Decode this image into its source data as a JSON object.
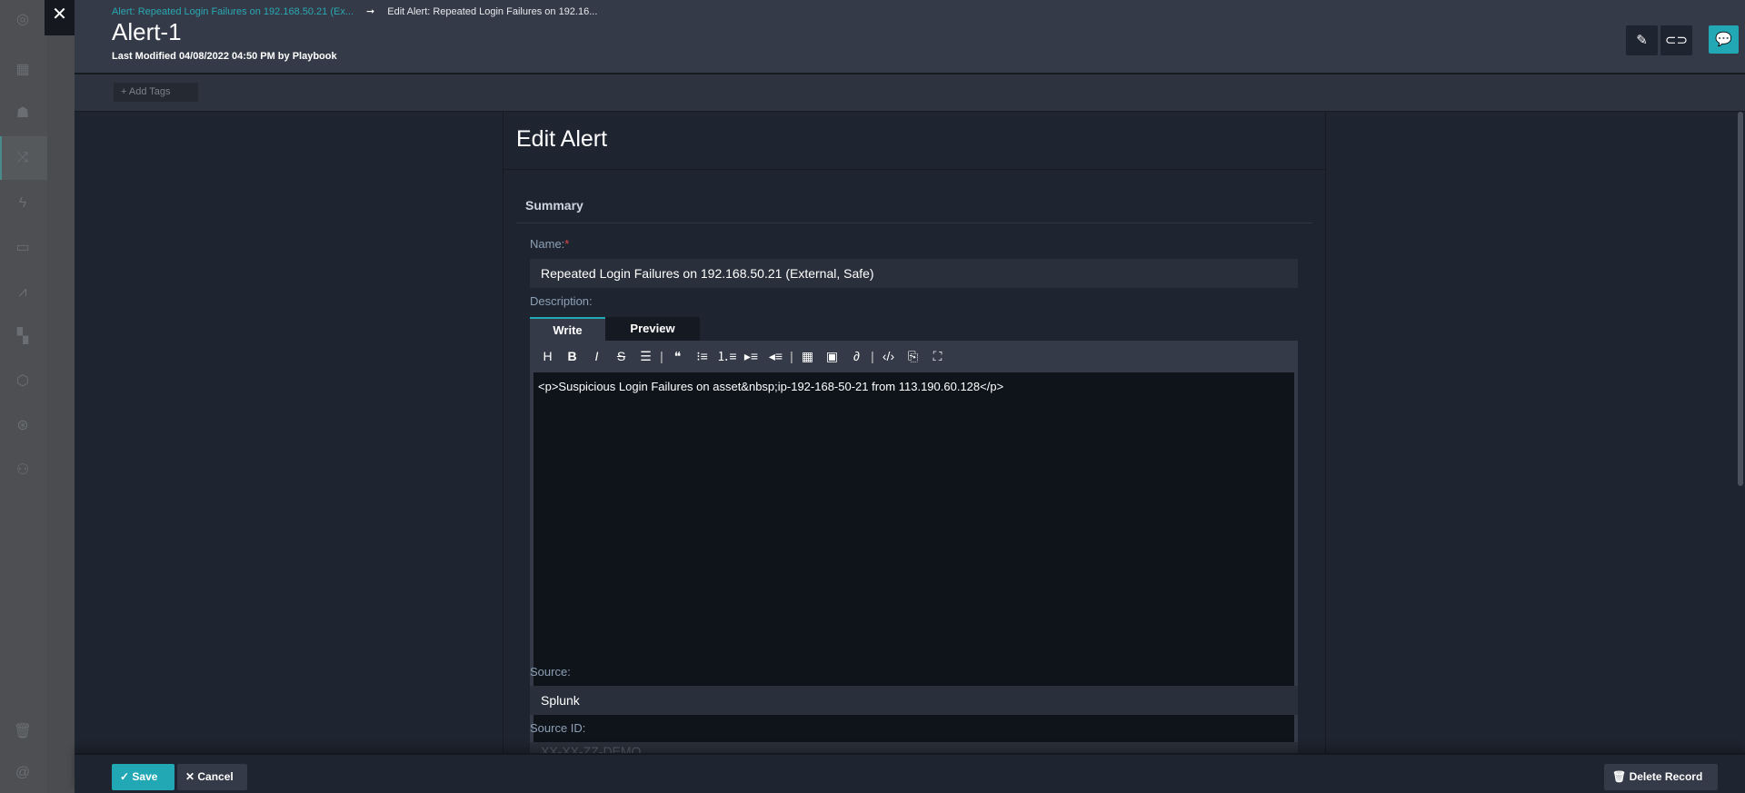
{
  "header": {
    "breadcrumb_parent": "Alert: Repeated Login Failures on 192.168.50.21 (Ex...",
    "breadcrumb_current": "Edit Alert: Repeated Login Failures on 192.16...",
    "title": "Alert-1",
    "last_modified": "Last Modified 04/08/2022 04:50 PM by Playbook",
    "status_color": "#4caf1f"
  },
  "tags": {
    "add_label": "+ Add Tags"
  },
  "panel": {
    "title": "Edit Alert",
    "section": "Summary",
    "name_label": "Name:",
    "required_mark": "*",
    "name_value": "Repeated Login Failures on 192.168.50.21 (External, Safe)",
    "description_label": "Description:",
    "tabs": [
      "Write",
      "Preview"
    ],
    "active_tab": "Write",
    "description_value": "<p>Suspicious Login Failures on asset&nbsp;ip-192-168-50-21 from 113.190.60.128</p>",
    "source_label": "Source:",
    "source_value": "Splunk",
    "source_id_label": "Source ID:",
    "source_id_value": "XX-XX-ZZ-DEMO"
  },
  "footer": {
    "save": "Save",
    "cancel": "Cancel",
    "delete": "Delete Record"
  },
  "colors": {
    "accent": "#22a8b4"
  }
}
